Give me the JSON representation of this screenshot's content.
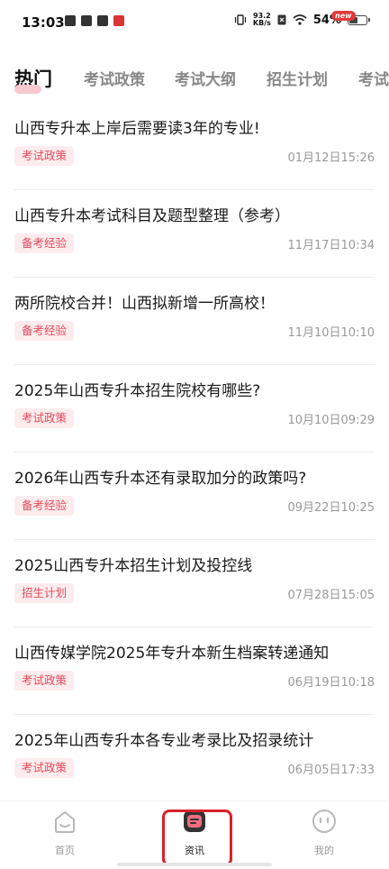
{
  "status_bar": {
    "time": "13:03",
    "net_speed_value": "93.2",
    "net_speed_unit": "KB/s",
    "battery_text": "54%",
    "battery_level": 0.54
  },
  "tabs": [
    {
      "label": "热门",
      "active": true
    },
    {
      "label": "考试政策",
      "active": false
    },
    {
      "label": "考试大纲",
      "active": false
    },
    {
      "label": "招生计划",
      "active": false
    },
    {
      "label": "考试",
      "active": false
    }
  ],
  "articles": [
    {
      "title": "山西专升本上岸后需要读3年的专业!",
      "tag": "考试政策",
      "date": "01月12日15:26"
    },
    {
      "title": "山西专升本考试科目及题型整理（参考）",
      "tag": "备考经验",
      "date": "11月17日10:34"
    },
    {
      "title": "两所院校合并！山西拟新增一所高校！",
      "tag": "备考经验",
      "date": "11月10日10:10"
    },
    {
      "title": "2025年山西专升本招生院校有哪些?",
      "tag": "考试政策",
      "date": "10月10日09:29"
    },
    {
      "title": "2026年山西专升本还有录取加分的政策吗?",
      "tag": "备考经验",
      "date": "09月22日10:25"
    },
    {
      "title": "2025山西专升本招生计划及投控线",
      "tag": "招生计划",
      "date": "07月28日15:05"
    },
    {
      "title": "山西传媒学院2025年专升本新生档案转递通知",
      "tag": "考试政策",
      "date": "06月19日10:18"
    },
    {
      "title": "2025年山西专升本各专业考录比及招录统计",
      "tag": "考试政策",
      "date": "06月05日17:33"
    }
  ],
  "bottom_nav": {
    "home": "首页",
    "news": "资讯",
    "me": "我的",
    "new_badge": "new"
  },
  "colors": {
    "accent": "#e24b5a",
    "tag_bg": "#fdecee",
    "highlight_frame": "#d8222a"
  }
}
